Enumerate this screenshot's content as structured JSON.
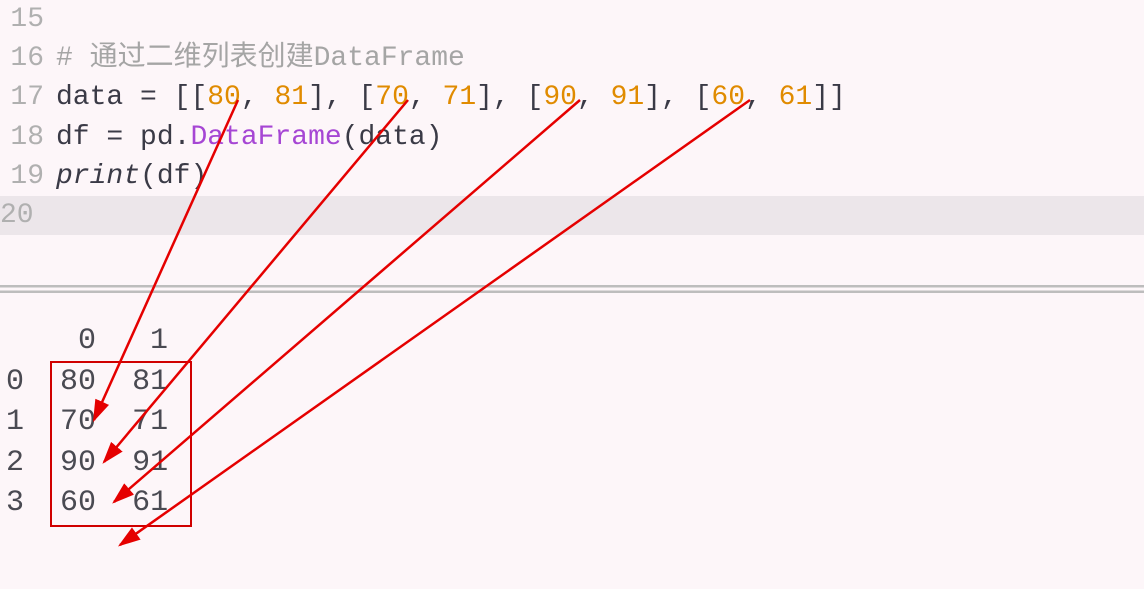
{
  "editor": {
    "lines": [
      {
        "num": "15",
        "type": "blank"
      },
      {
        "num": "16",
        "type": "comment",
        "text": "# 通过二维列表创建DataFrame"
      },
      {
        "num": "17",
        "type": "data-assign",
        "lhs": "data",
        "eq": " = ",
        "rows": [
          {
            "a": "80",
            "b": "81"
          },
          {
            "a": "70",
            "b": "71"
          },
          {
            "a": "90",
            "b": "91"
          },
          {
            "a": "60",
            "b": "61"
          }
        ]
      },
      {
        "num": "18",
        "type": "df-assign",
        "lhs": "df",
        "eq": " = ",
        "mod": "pd",
        "dot": ".",
        "cls": "DataFrame",
        "open": "(",
        "arg": "data",
        "close": ")"
      },
      {
        "num": "19",
        "type": "print",
        "fn": "print",
        "open": "(",
        "arg": "df",
        "close": ")"
      },
      {
        "num": "20",
        "type": "highlighted"
      }
    ]
  },
  "output": {
    "header": "    0   1",
    "rows": [
      {
        "idx": "0",
        "c0": "80",
        "c1": "81"
      },
      {
        "idx": "1",
        "c0": "70",
        "c1": "71"
      },
      {
        "idx": "2",
        "c0": "90",
        "c1": "91"
      },
      {
        "idx": "3",
        "c0": "60",
        "c1": "61"
      }
    ]
  }
}
